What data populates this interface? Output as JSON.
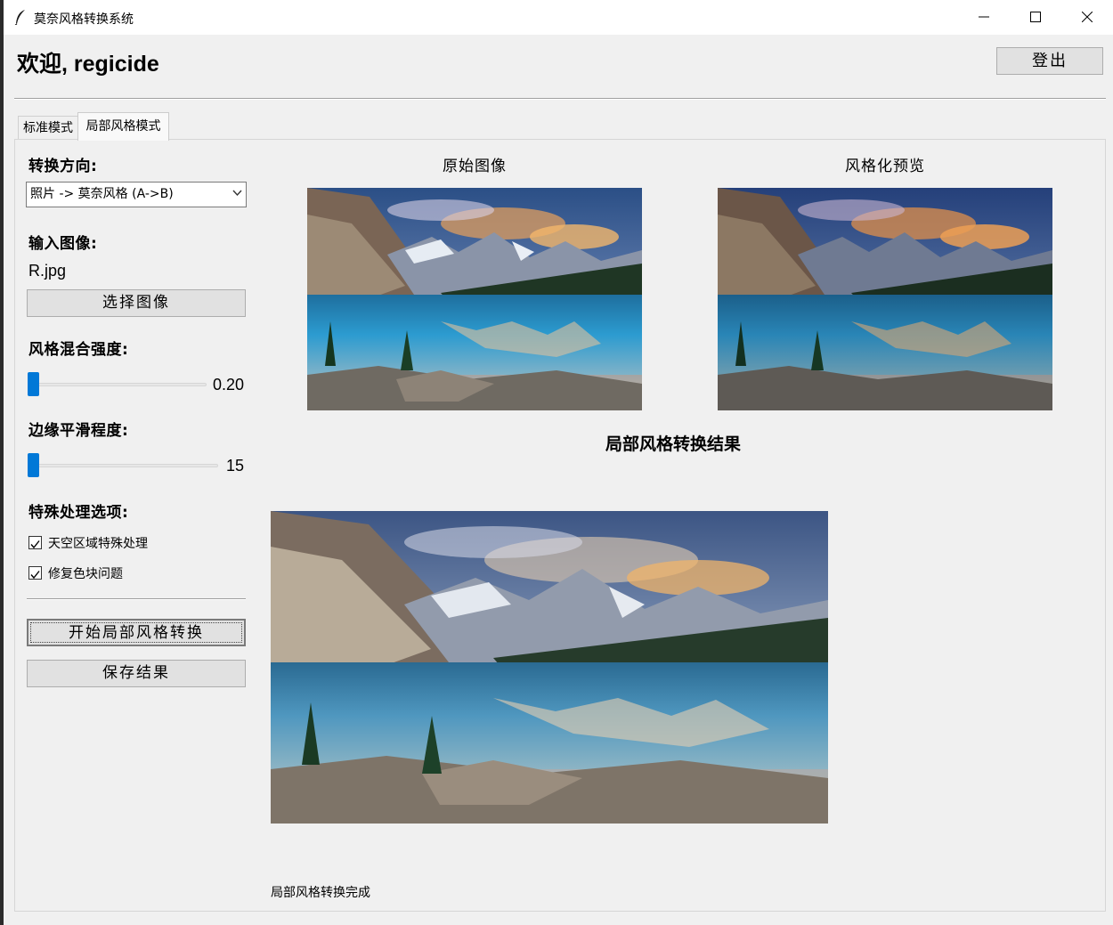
{
  "window": {
    "title": "莫奈风格转换系统"
  },
  "header": {
    "welcome": "欢迎, regicide",
    "logout_label": "登出"
  },
  "tabs": [
    {
      "label": "标准模式",
      "selected": false
    },
    {
      "label": "局部风格模式",
      "selected": true
    }
  ],
  "controls": {
    "direction_label": "转换方向:",
    "direction_value": "照片 -> 莫奈风格 (A->B)",
    "input_label": "输入图像:",
    "input_filename": "R.jpg",
    "choose_label": "选择图像",
    "blend_label": "风格混合强度:",
    "blend_value": "0.20",
    "blend_fraction": 0.0,
    "smooth_label": "边缘平滑程度:",
    "smooth_value": "15",
    "smooth_fraction": 0.0,
    "special_label": "特殊处理选项:",
    "options": [
      {
        "label": "天空区域特殊处理",
        "checked": true
      },
      {
        "label": "修复色块问题",
        "checked": true
      }
    ],
    "start_label": "开始局部风格转换",
    "save_label": "保存结果"
  },
  "images": {
    "original_title": "原始图像",
    "preview_title": "风格化预览",
    "result_title": "局部风格转换结果"
  },
  "status": "局部风格转换完成",
  "colors": {
    "accent": "#0078d7",
    "background": "#f0f0f0"
  }
}
